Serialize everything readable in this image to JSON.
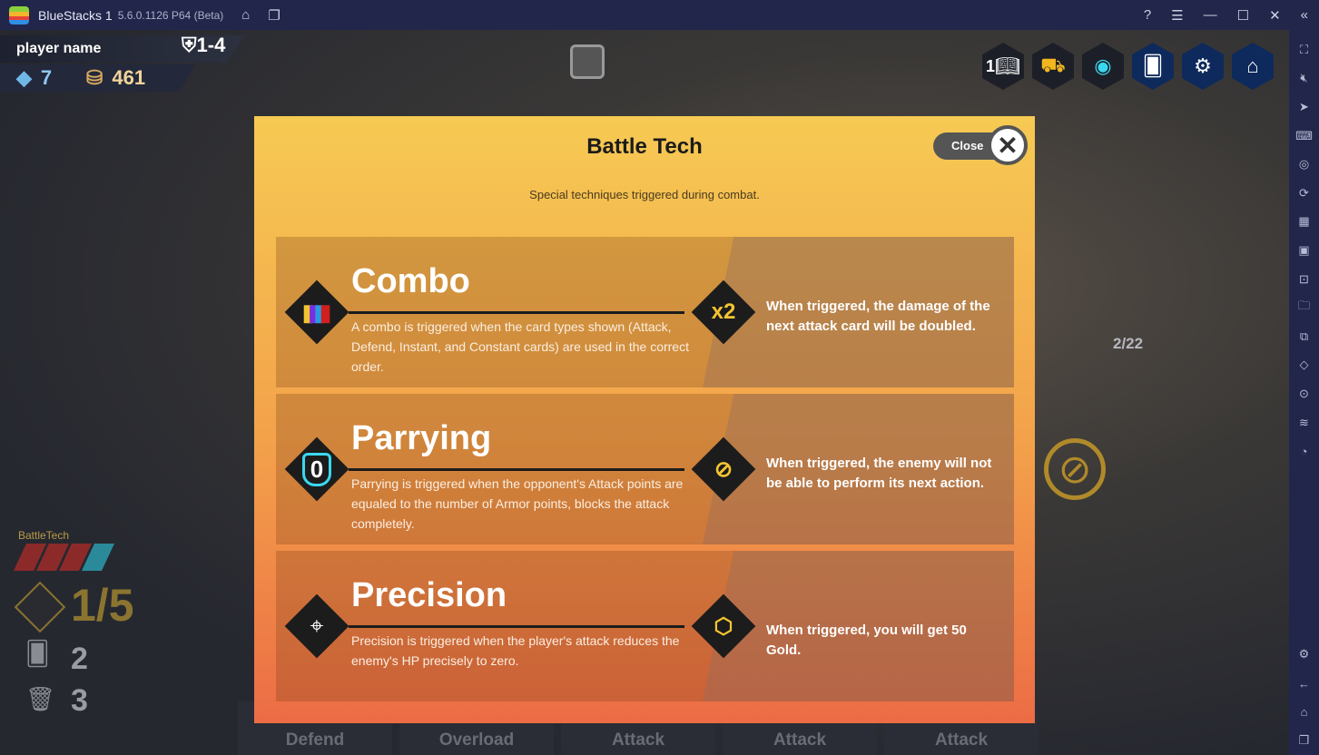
{
  "titlebar": {
    "app_name": "BlueStacks 1",
    "version": "5.6.0.1126 P64 (Beta)"
  },
  "hud": {
    "player_name": "player name",
    "level": "1-4",
    "gems": "7",
    "gold": "461",
    "book_count": "1",
    "battle_tech_label": "BattleTech",
    "turn": "1/5",
    "draw_count": "2",
    "discard_count": "3",
    "enemy_counter": "2/22"
  },
  "cards": [
    "Defend",
    "Overload",
    "Attack",
    "Attack",
    "Attack"
  ],
  "modal": {
    "title": "Battle Tech",
    "subtitle": "Special techniques triggered during combat.",
    "close_label": "Close",
    "techs": [
      {
        "name": "Combo",
        "description": "A combo is triggered when the card types shown (Attack, Defend, Instant, and Constant cards) are used in the correct order.",
        "effect": "When triggered, the damage of the next attack card will be doubled.",
        "effect_badge": "x2"
      },
      {
        "name": "Parrying",
        "description": "Parrying is triggered when the opponent's Attack points are equaled to the number of Armor points, blocks the attack completely.",
        "effect": "When triggered, the enemy will not be able to perform its next action.",
        "badge": "0"
      },
      {
        "name": "Precision",
        "description": "Precision is triggered when the player's attack reduces the enemy's HP precisely to zero.",
        "effect": "When triggered, you will get 50 Gold."
      }
    ]
  },
  "colors": {
    "modal_top": "#f6ca53",
    "modal_bottom": "#ec6c45",
    "sidebar": "#22264a"
  }
}
